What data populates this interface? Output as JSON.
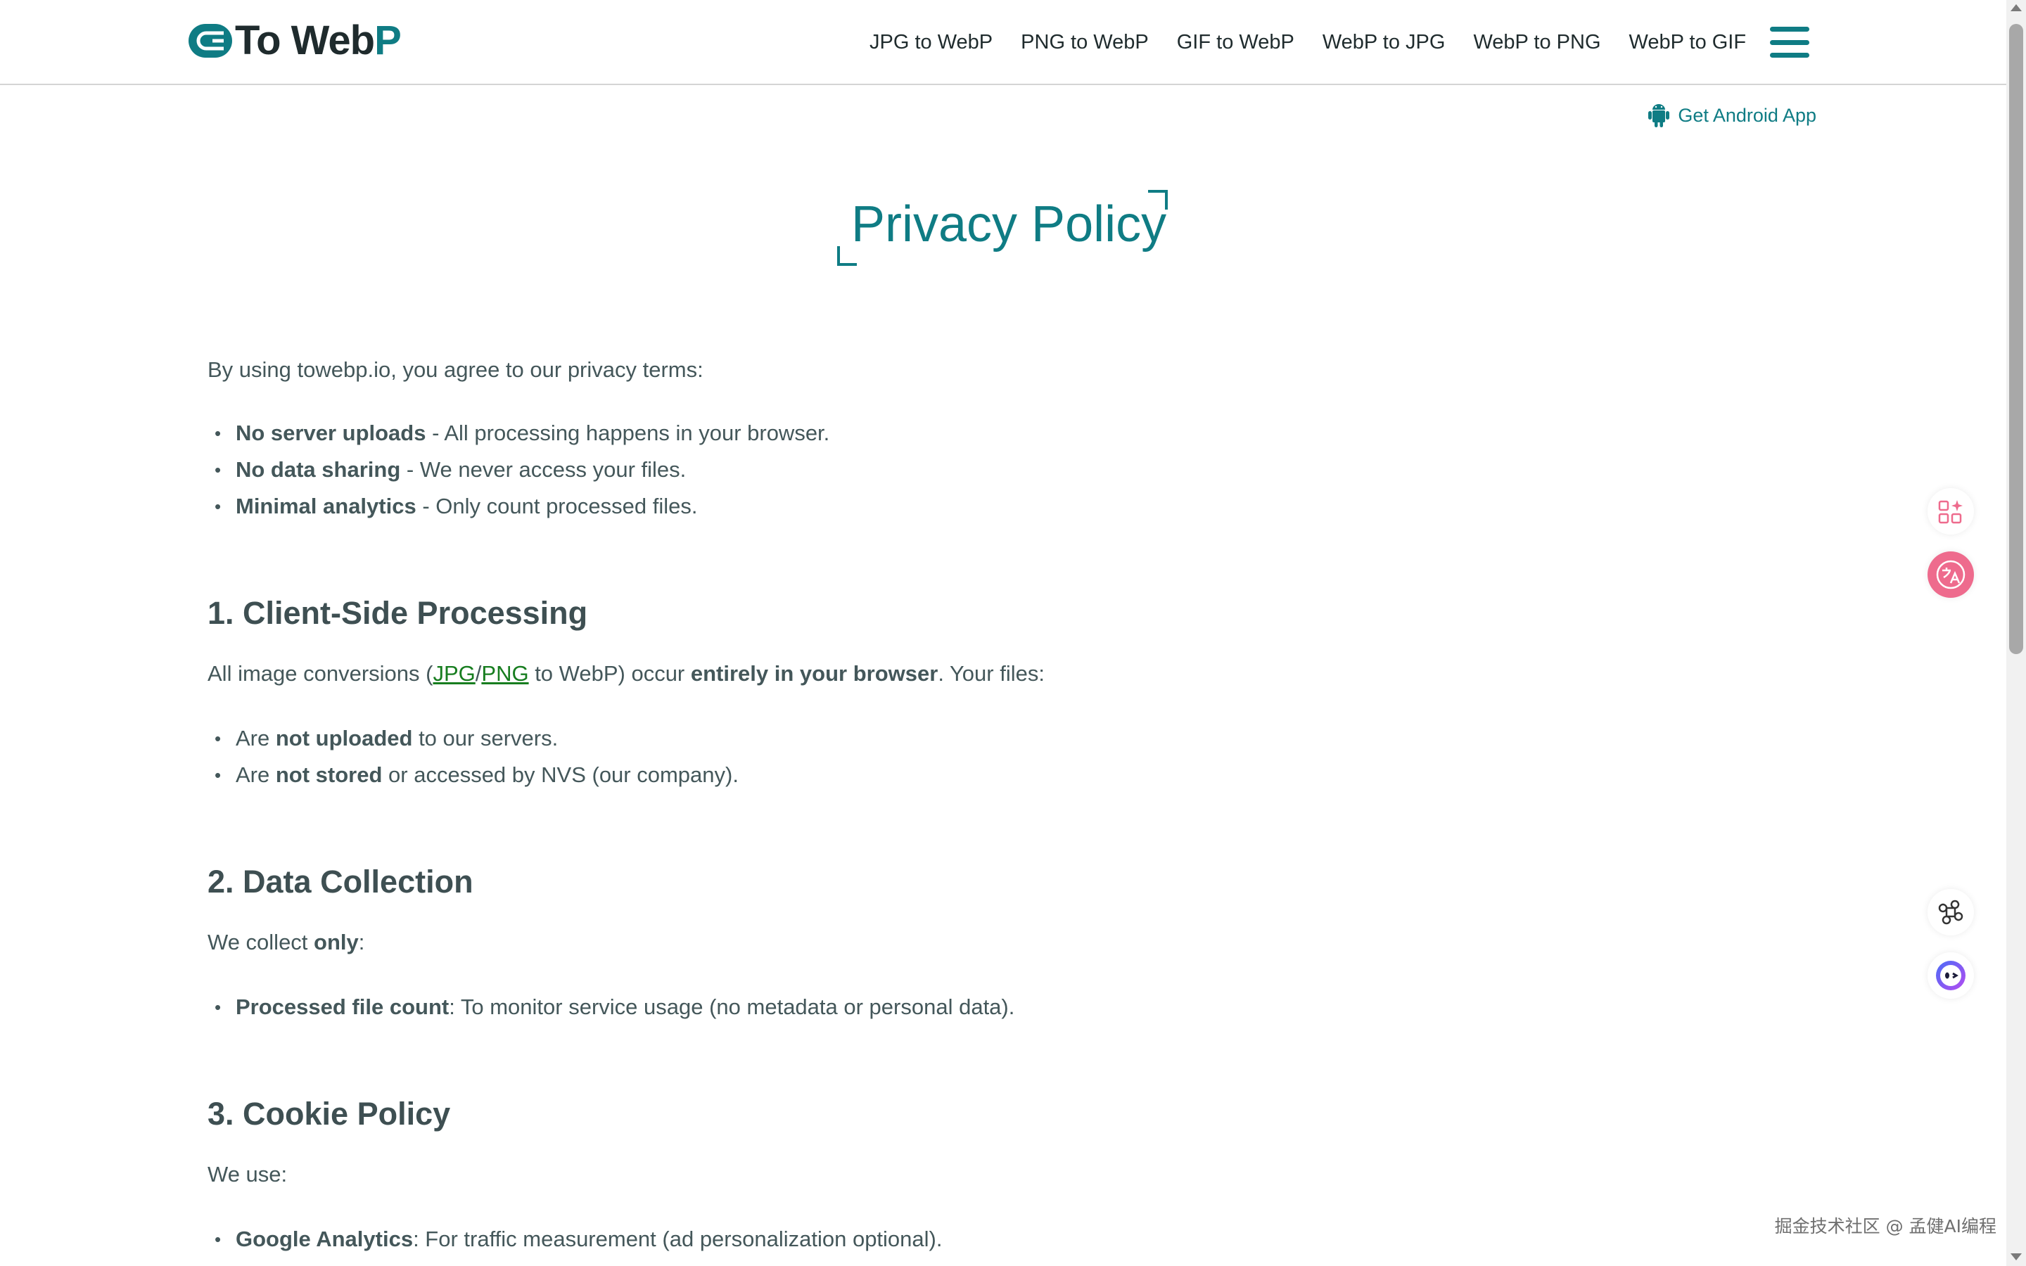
{
  "header": {
    "logo": {
      "part1": "To Web",
      "part2": "P"
    },
    "nav": [
      {
        "label": "JPG to WebP"
      },
      {
        "label": "PNG to WebP"
      },
      {
        "label": "GIF to WebP"
      },
      {
        "label": "WebP to JPG"
      },
      {
        "label": "WebP to PNG"
      },
      {
        "label": "WebP to GIF"
      }
    ],
    "menu_icon": "hamburger-icon"
  },
  "android_link": {
    "label": "Get Android App",
    "icon": "android-icon"
  },
  "page_title": "Privacy Policy",
  "intro": "By using towebp.io, you agree to our privacy terms:",
  "intro_points": [
    {
      "bold": "No server uploads",
      "text": " - All processing happens in your browser."
    },
    {
      "bold": "No data sharing",
      "text": " - We never access your files."
    },
    {
      "bold": "Minimal analytics",
      "text": " - Only count processed files."
    }
  ],
  "section1": {
    "heading": "1. Client-Side Processing",
    "p_before": "All image conversions (",
    "link_jpg": "JPG",
    "slash": "/",
    "link_png": "PNG",
    "p_middle": " to WebP) occur ",
    "p_bold": "entirely in your browser",
    "p_after": ". Your files:",
    "points": [
      {
        "pre": "Are ",
        "bold": "not uploaded",
        "text": " to our servers."
      },
      {
        "pre": "Are ",
        "bold": "not stored",
        "text": " or accessed by NVS (our company)."
      }
    ]
  },
  "section2": {
    "heading": "2. Data Collection",
    "p_before": "We collect ",
    "p_bold": "only",
    "p_after": ":",
    "points": [
      {
        "bold": "Processed file count",
        "text": ": To monitor service usage (no metadata or personal data)."
      }
    ]
  },
  "section3": {
    "heading": "3. Cookie Policy",
    "p": "We use:",
    "points": [
      {
        "bold": "Google Analytics",
        "text": ": For traffic measurement (ad personalization optional)."
      }
    ]
  },
  "floating_widgets": [
    "apps-sparkle-icon",
    "translate-icon",
    "command-icon",
    "assistant-face-icon"
  ],
  "watermark": "掘金技术社区 @ 孟健AI编程",
  "colors": {
    "brand": "#0f7c84",
    "text": "#44575a",
    "link": "#177d1f",
    "widget_pink": "#ee6b8d"
  }
}
